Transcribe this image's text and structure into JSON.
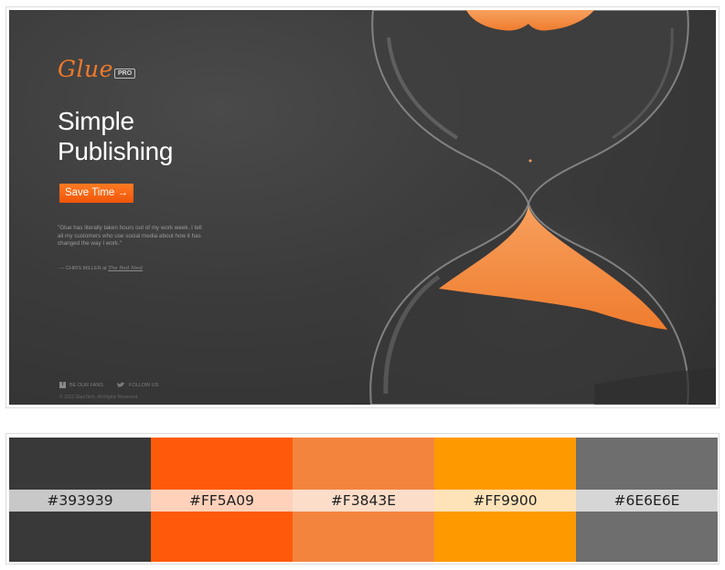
{
  "hero": {
    "logo": "Glue",
    "badge": "PRO",
    "headline_line1": "Simple",
    "headline_line2": "Publishing",
    "cta_label": "Save Time →",
    "quote": "\"Glue has literally taken hours out of my work week. I tell all my customers who use social media about how it has changed the way I work.\"",
    "cite_prefix": "— CHRIS MILLER at",
    "cite_publication": "The Red Nest",
    "social_fans": "BE OUR FANS",
    "social_follow": "FOLLOW US",
    "copyright": "© 2012 GlueTech, All Rights Reserved.",
    "icons": [
      "facebook-icon",
      "twitter-bird-icon",
      "hourglass-illustration"
    ]
  },
  "palette": {
    "swatches": [
      {
        "hex": "#393939"
      },
      {
        "hex": "#FF5A09"
      },
      {
        "hex": "#F3843E"
      },
      {
        "hex": "#FF9900"
      },
      {
        "hex": "#6E6E6E"
      }
    ]
  },
  "colors": {
    "background": "#393939",
    "accent": "#FF5A09",
    "sand": "#F3843E"
  }
}
